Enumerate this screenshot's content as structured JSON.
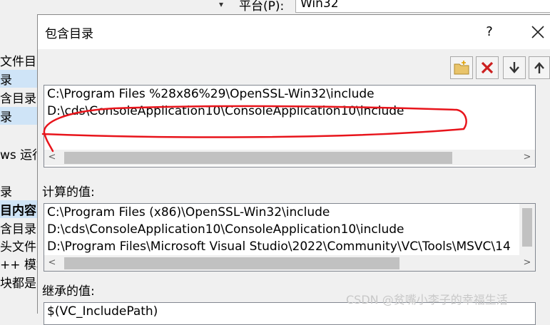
{
  "background": {
    "platform_label": "平台(P):",
    "platform_value": "Win32",
    "left_items": [
      "文件目",
      "录",
      "含目录",
      "录",
      "ws 运行",
      "录",
      "目内容",
      "含目录",
      "头文件",
      "++ 模块",
      "块都是"
    ]
  },
  "dialog": {
    "title": "包含目录",
    "help": "?",
    "include_dirs": [
      "C:\\Program Files %28x86%29\\OpenSSL-Win32\\include",
      "D:\\cds\\ConsoleApplication10\\ConsoleApplication10\\include"
    ],
    "computed_label": "计算的值:",
    "computed_values": [
      "C:\\Program Files (x86)\\OpenSSL-Win32\\include",
      "D:\\cds\\ConsoleApplication10\\ConsoleApplication10\\include",
      "D:\\Program Files\\Microsoft Visual Studio\\2022\\Community\\VC\\Tools\\MSVC\\14"
    ],
    "inherited_label": "继承的值:",
    "inherited_values": [
      "$(VC_IncludePath)"
    ]
  },
  "watermark": "CSDN @贫嘴小李子的幸福生活",
  "colors": {
    "annotation": "#e8141b",
    "selection": "#cfe4f7"
  }
}
